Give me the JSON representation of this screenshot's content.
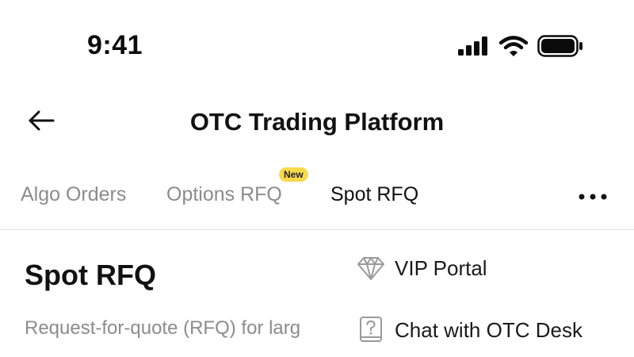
{
  "status_bar": {
    "time": "9:41",
    "icons": [
      "signal-icon",
      "wifi-icon",
      "battery-icon"
    ]
  },
  "header": {
    "back_icon": "arrow-left-icon",
    "title": "OTC Trading Platform"
  },
  "tabs": [
    {
      "label": "Algo Orders",
      "active": false
    },
    {
      "label": "Options RFQ",
      "active": false,
      "badge": "New"
    },
    {
      "label": "Spot RFQ",
      "active": true
    }
  ],
  "more_icon": "more-horizontal-icon",
  "content": {
    "title": "Spot RFQ",
    "description": "Request-for-quote (RFQ) for larg"
  },
  "menu": {
    "items": [
      {
        "label": "VIP Portal",
        "icon": "diamond-icon"
      },
      {
        "label": "Chat with OTC Desk",
        "icon": "help-book-icon"
      }
    ]
  },
  "colors": {
    "badge": "#f7d94c",
    "text_primary": "#111111",
    "text_secondary": "#8c8c8c",
    "divider": "#e6e6e6"
  }
}
